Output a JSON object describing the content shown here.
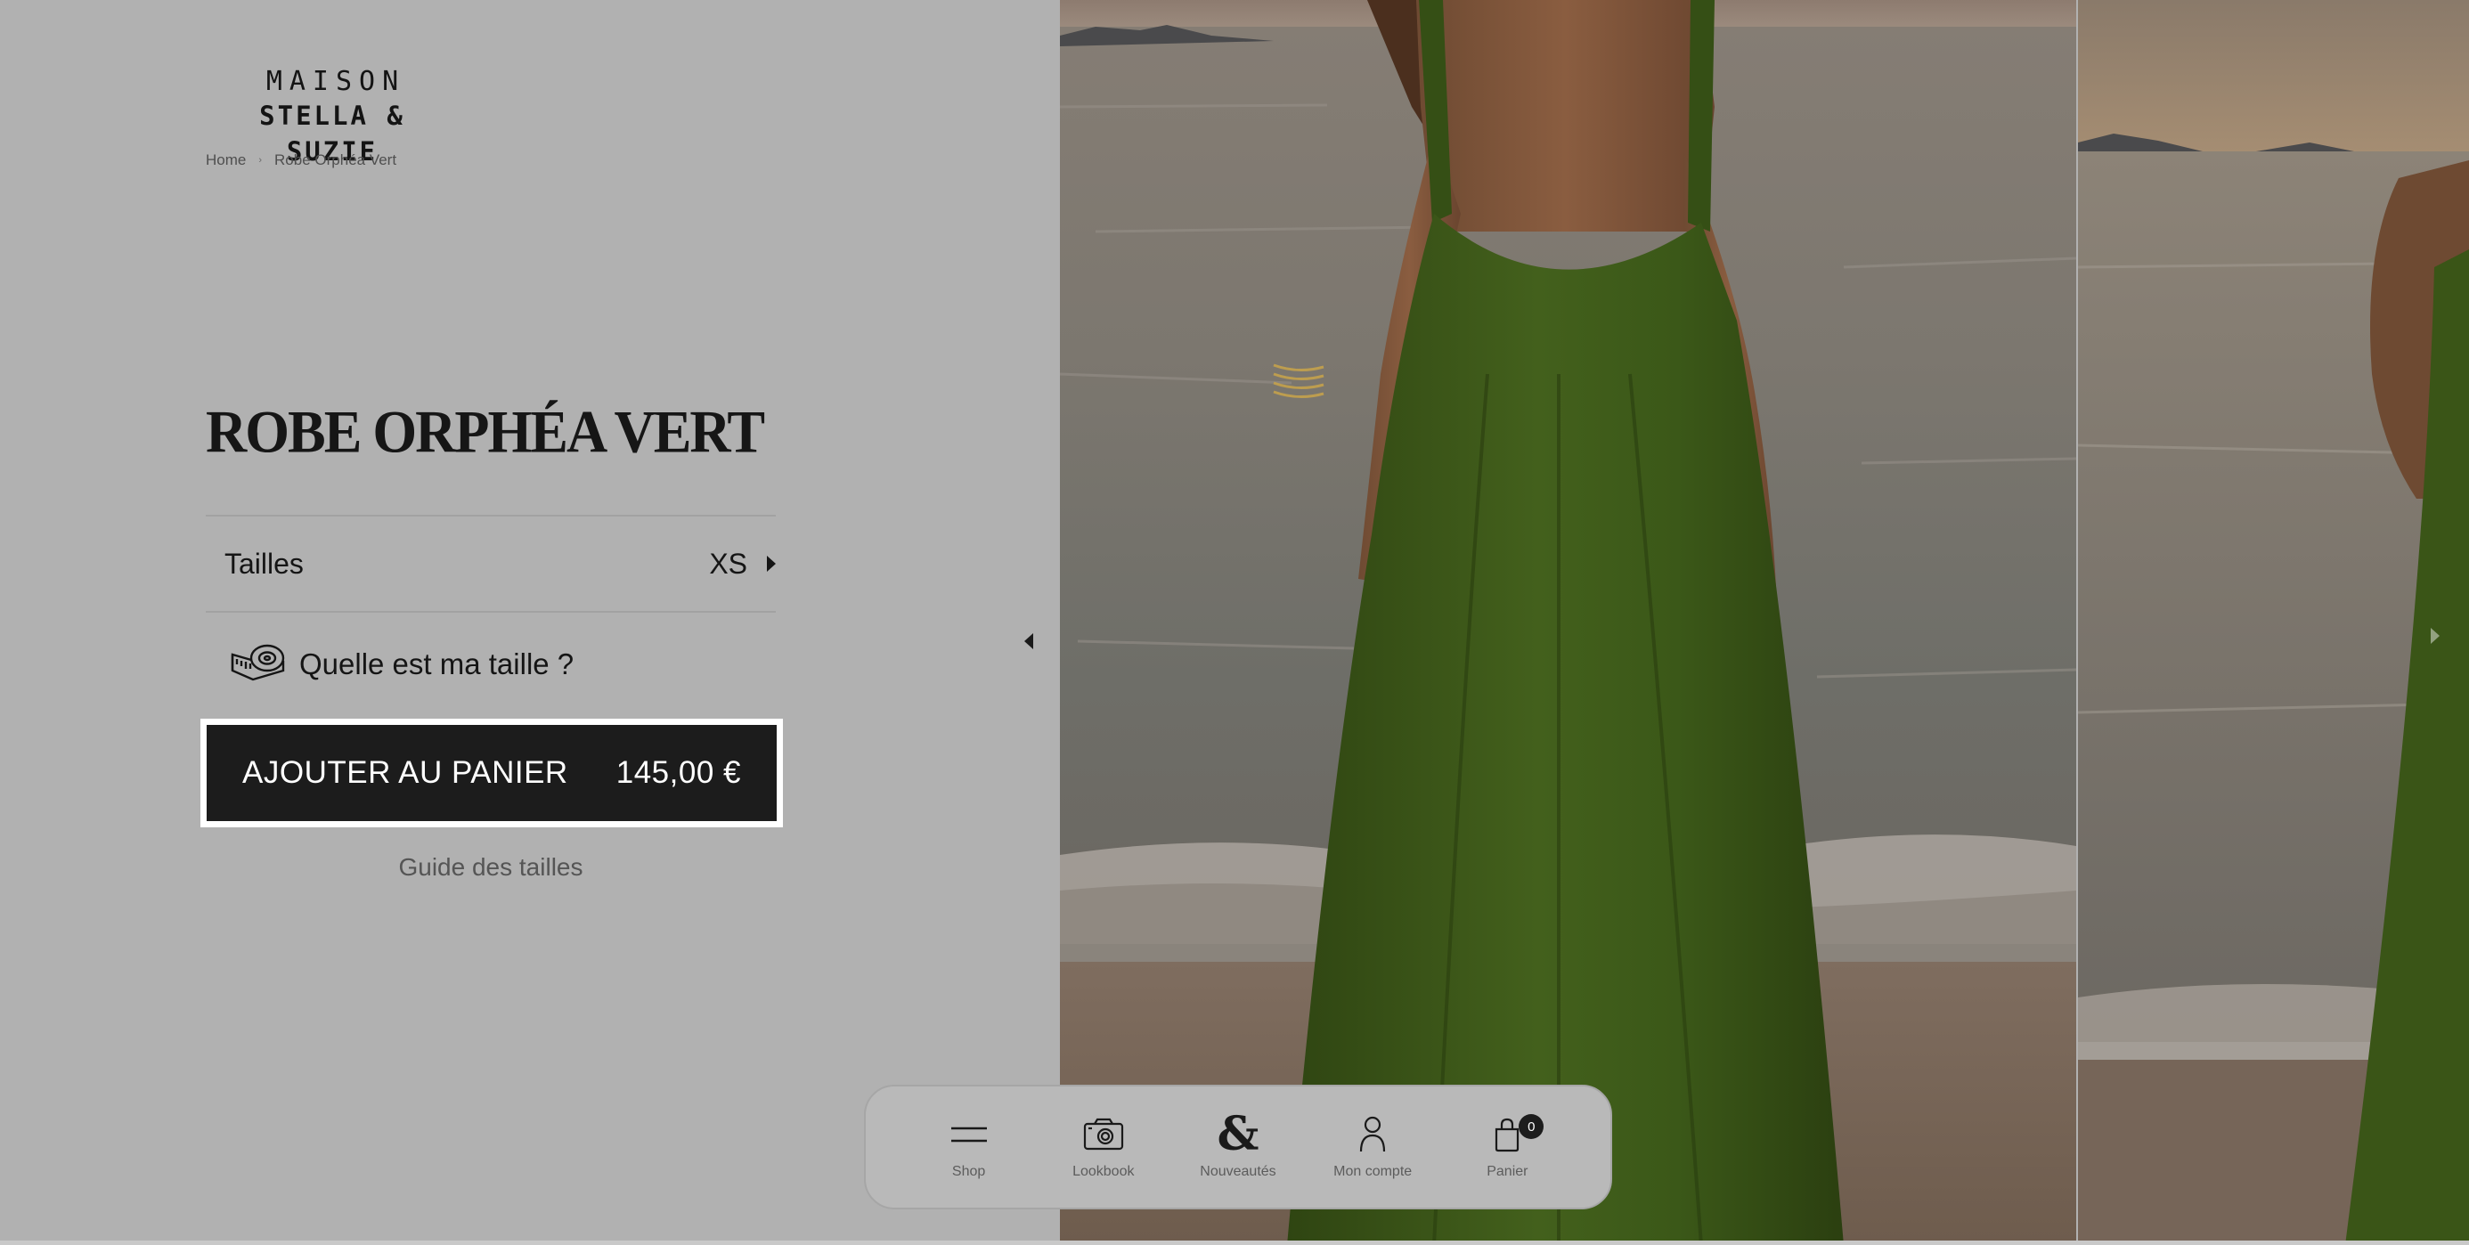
{
  "brand": {
    "line1": "MAISON",
    "line2": "STELLA & SUZIE"
  },
  "breadcrumb": {
    "home": "Home",
    "separator": "›",
    "current": "Robe Orphéa Vert"
  },
  "product": {
    "title": "ROBE ORPHÉA VERT",
    "size_label": "Tailles",
    "size_value": "XS",
    "size_help": "Quelle est ma taille ?",
    "add_to_cart": "AJOUTER AU PANIER",
    "price": "145,00 €",
    "size_guide": "Guide des tailles"
  },
  "gallery": {
    "images": [
      {
        "alt": "woman in green dress walking on beach, back view"
      },
      {
        "alt": "woman in green dress on beach at sunset"
      }
    ]
  },
  "bottom_nav": {
    "items": [
      {
        "label": "Shop",
        "icon": "menu-icon"
      },
      {
        "label": "Lookbook",
        "icon": "camera-icon"
      },
      {
        "label": "Nouveautés",
        "icon": "ampersand-icon"
      },
      {
        "label": "Mon compte",
        "icon": "user-icon"
      },
      {
        "label": "Panier",
        "icon": "bag-icon"
      }
    ],
    "amp_glyph": "&",
    "cart_count": "0"
  },
  "colors": {
    "overlay_gray": "#b1b1b1",
    "button_dark": "#1c1c1c",
    "dress_green": "#3e5a1c"
  }
}
